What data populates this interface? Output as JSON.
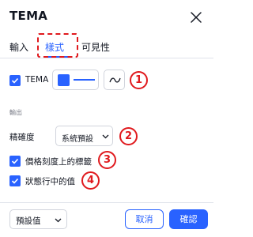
{
  "dialog": {
    "title": "TEMA",
    "close_icon": "close-icon"
  },
  "tabs": [
    {
      "label": "輸入",
      "active": false
    },
    {
      "label": "樣式",
      "active": true
    },
    {
      "label": "可見性",
      "active": false
    }
  ],
  "style": {
    "plot_label": "TEMA",
    "plot_checked": true,
    "plot_color": "#2962ff",
    "line_style_icon": "wave-line-icon",
    "section_output": "輸出",
    "precision_label": "精確度",
    "precision_value": "系統預設",
    "price_scale_label": "價格刻度上的標籤",
    "price_scale_checked": true,
    "status_line_label": "狀態行中的值",
    "status_line_checked": true
  },
  "annotations": [
    "1",
    "2",
    "3",
    "4"
  ],
  "footer": {
    "defaults_label": "預設值",
    "cancel_label": "取消",
    "ok_label": "確認"
  },
  "colors": {
    "accent": "#2962ff",
    "annotation": "#e0191d"
  }
}
